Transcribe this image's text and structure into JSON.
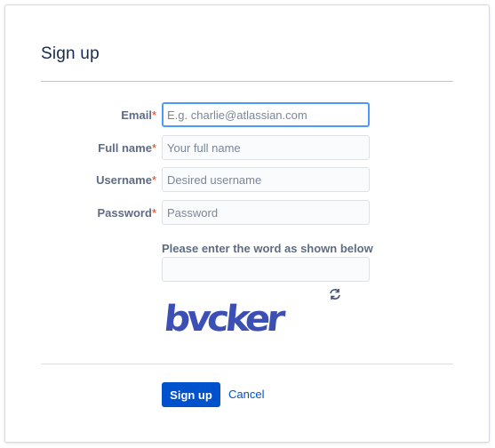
{
  "page": {
    "title": "Sign up"
  },
  "form": {
    "required_marker": "*",
    "fields": [
      {
        "label": "Email",
        "placeholder": "E.g. charlie@atlassian.com",
        "value": ""
      },
      {
        "label": "Full name",
        "placeholder": "Your full name",
        "value": ""
      },
      {
        "label": "Username",
        "placeholder": "Desired username",
        "value": ""
      },
      {
        "label": "Password",
        "placeholder": "Password",
        "value": ""
      }
    ],
    "captcha": {
      "label": "Please enter the word as shown below",
      "value": "",
      "image_word": "bvcker",
      "image_color": "#3b4fb4",
      "refresh_icon": "refresh-icon"
    }
  },
  "actions": {
    "submit_label": "Sign up",
    "cancel_label": "Cancel"
  },
  "colors": {
    "primary": "#0052cc",
    "required": "#de350b",
    "focus_border": "#4c9aff"
  }
}
